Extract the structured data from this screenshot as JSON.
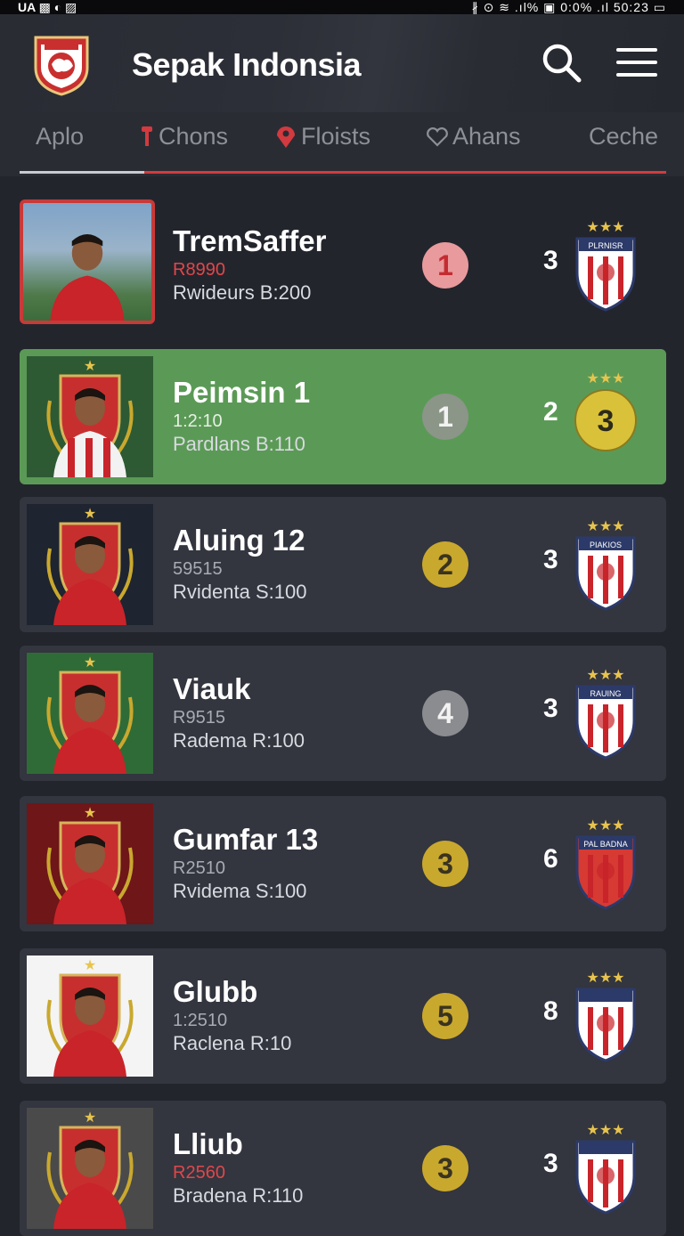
{
  "status_bar": {
    "left": "UA ▩ ◐ ▨",
    "right": "∦ ⊙ ≋ .ıl% ▣ 0:0% .ıl 50:23 ▭"
  },
  "app": {
    "title": "Sepak Indonsia"
  },
  "tabs": [
    {
      "label": "Aplo",
      "icon": ""
    },
    {
      "label": "Chons",
      "icon": "pin-icon"
    },
    {
      "label": "Floists",
      "icon": "location-icon"
    },
    {
      "label": "Ahans",
      "icon": "heart-icon"
    },
    {
      "label": "Ceche",
      "icon": ""
    }
  ],
  "colors": {
    "accent": "#d23a3f",
    "highlight": "#5b9a56",
    "gold": "#c9a82e",
    "grey": "#8a8c90"
  },
  "players": [
    {
      "name": "TremSaffer",
      "code": "R8990",
      "sub": "Rwideurs B:200",
      "rank": "1",
      "rank_color": "#e99a9c",
      "rank_text": "#c42b31",
      "points": "3",
      "badge_text": "PLRNISR",
      "avatar_bg": "stadium",
      "badge_stars": "★★★"
    },
    {
      "name": "Peimsin 1",
      "code": "1:2:10",
      "sub": "Pardlans B:110",
      "rank": "1",
      "rank_color": "#8b9588",
      "rank_text": "#f2f2f2",
      "points": "2",
      "badge_text": "3",
      "avatar_bg": "#2d5a33",
      "badge_stars": "★★★"
    },
    {
      "name": "Aluing 12",
      "code": "59515",
      "sub": "Rvidenta S:100",
      "rank": "2",
      "rank_color": "#c9a82e",
      "rank_text": "#3a3320",
      "points": "3",
      "badge_text": "PIAKIOS",
      "avatar_bg": "#1e2430",
      "badge_stars": "★★★"
    },
    {
      "name": "Viauk",
      "code": "R9515",
      "sub": "Radema R:100",
      "rank": "4",
      "rank_color": "#8a8c90",
      "rank_text": "#f2f2f2",
      "points": "3",
      "badge_text": "RAUING",
      "avatar_bg": "#2f6b36",
      "badge_stars": "★★★"
    },
    {
      "name": "Gumfar 13",
      "code": "R2510",
      "sub": "Rvidema S:100",
      "rank": "3",
      "rank_color": "#c9a82e",
      "rank_text": "#3a3320",
      "points": "6",
      "badge_text": "PAL BADNA",
      "avatar_bg": "#6e1618",
      "badge_stars": "★★★"
    },
    {
      "name": "Glubb",
      "code": "1:2510",
      "sub": "Raclena R:10",
      "rank": "5",
      "rank_color": "#c9a82e",
      "rank_text": "#3a3320",
      "points": "8",
      "badge_text": "",
      "avatar_bg": "#f4f4f4",
      "badge_stars": "★★★"
    },
    {
      "name": "Lliub",
      "code": "R2560",
      "sub": "Bradena R:110",
      "rank": "3",
      "rank_color": "#c9a82e",
      "rank_text": "#3a3320",
      "points": "3",
      "badge_text": "",
      "avatar_bg": "#4a4a4a",
      "badge_stars": "★★★"
    }
  ]
}
